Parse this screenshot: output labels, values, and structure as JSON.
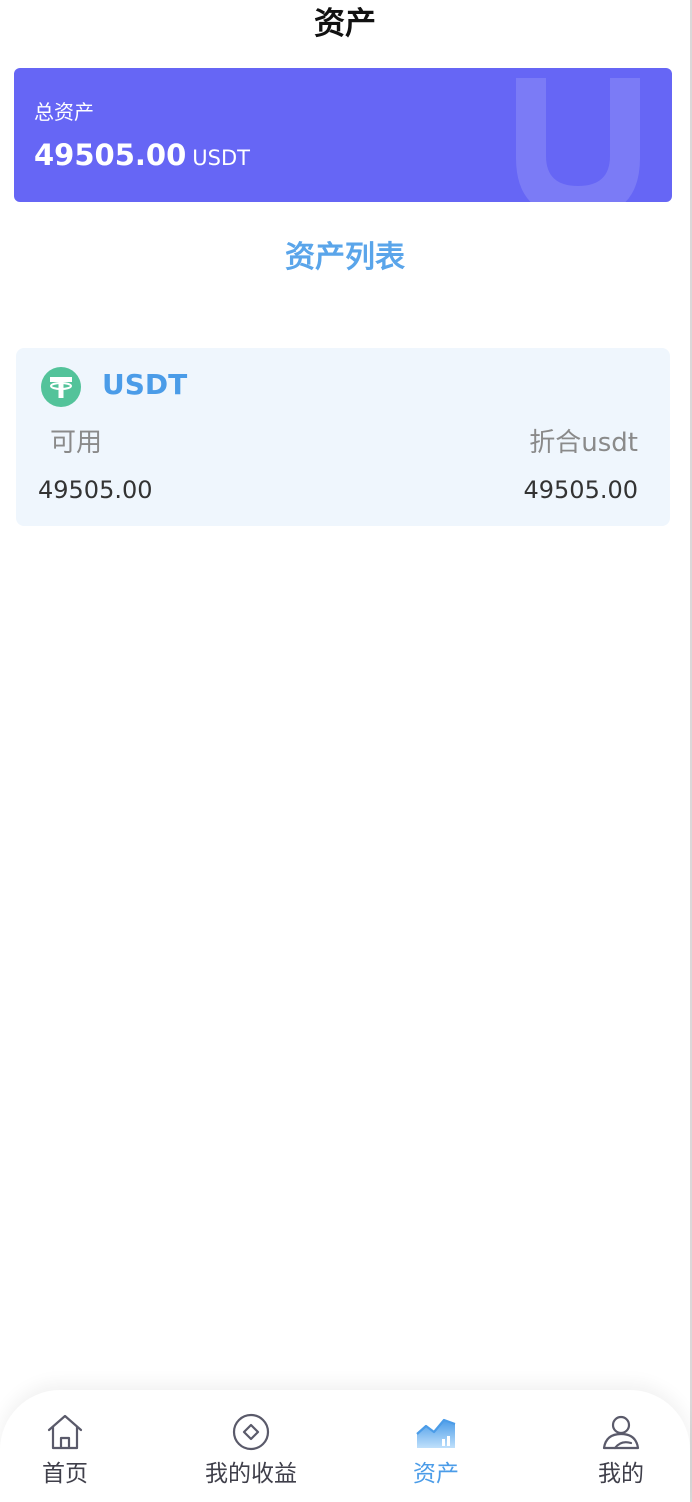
{
  "header": {
    "title": "资产"
  },
  "total_card": {
    "label": "总资产",
    "amount": "49505.00",
    "unit": "USDT",
    "watermark_letter": "U",
    "background": "#6666f5"
  },
  "section": {
    "title": "资产列表"
  },
  "assets": [
    {
      "icon": "tether-icon",
      "name": "USDT",
      "available_label": "可用",
      "converted_label": "折合usdt",
      "available_value": "49505.00",
      "converted_value": "49505.00"
    }
  ],
  "nav": {
    "items": [
      {
        "label": "首页",
        "icon": "home-icon",
        "active": false
      },
      {
        "label": "我的收益",
        "icon": "earnings-icon",
        "active": false
      },
      {
        "label": "资产",
        "icon": "assets-chart-icon",
        "active": true
      },
      {
        "label": "我的",
        "icon": "user-icon",
        "active": false
      }
    ]
  },
  "colors": {
    "accent": "#4b9ce8",
    "card_bg": "#eff6fd",
    "tether_green": "#53c39a"
  }
}
